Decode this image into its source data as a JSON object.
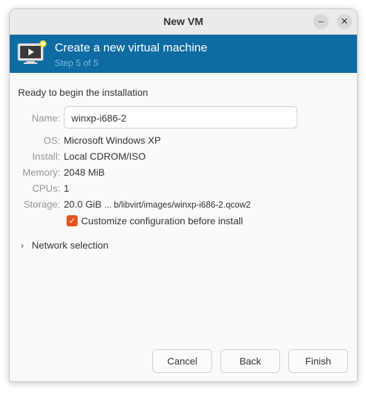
{
  "window": {
    "title": "New VM"
  },
  "titlebar_buttons": {
    "minimize_glyph": "–",
    "close_glyph": "✕"
  },
  "banner": {
    "title": "Create a new virtual machine",
    "subtitle": "Step 5 of 5",
    "icon": "monitor-play-icon",
    "background_color": "#0f6ca3"
  },
  "main": {
    "heading": "Ready to begin the installation",
    "name": {
      "label": "Name:",
      "value": "winxp-i686-2"
    },
    "os": {
      "label": "OS:",
      "value": "Microsoft Windows XP"
    },
    "install": {
      "label": "Install:",
      "value": "Local CDROM/ISO"
    },
    "memory": {
      "label": "Memory:",
      "value": "2048 MiB"
    },
    "cpus": {
      "label": "CPUs:",
      "value": "1"
    },
    "storage": {
      "label": "Storage:",
      "size": "20.0 GiB",
      "path": "... b/libvirt/images/winxp-i686-2.qcow2"
    },
    "customize": {
      "label": "Customize configuration before install",
      "checked": true,
      "check_glyph": "✓",
      "accent_color": "#e9541e"
    },
    "network_expander": {
      "label": "Network selection",
      "chevron": "›"
    }
  },
  "footer": {
    "cancel": "Cancel",
    "back": "Back",
    "finish": "Finish"
  }
}
